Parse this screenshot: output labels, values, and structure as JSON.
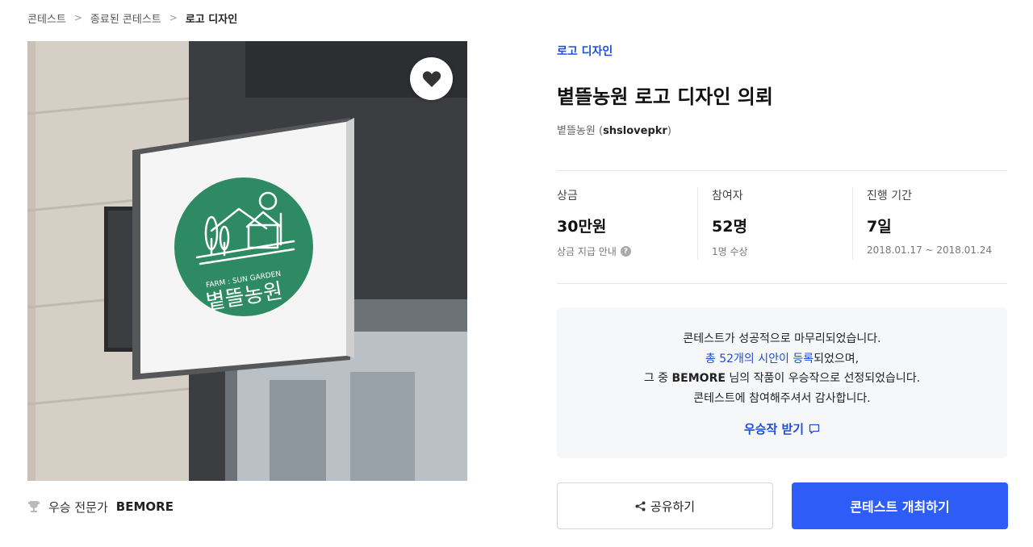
{
  "breadcrumb": {
    "items": [
      "콘테스트",
      "종료된 콘테스트",
      "로고 디자인"
    ]
  },
  "hero": {
    "logo_en": "FARM : SUN GARDEN",
    "logo_ko": "볕뜰농원",
    "logo_color": "#2e8a62"
  },
  "winner": {
    "label": "우승 전문가",
    "name": "BEMORE"
  },
  "contest": {
    "category": "로고 디자인",
    "title": "볕뜰농원 로고 디자인 의뢰",
    "owner_name": "볕뜰농원",
    "owner_id": "shslovepkr"
  },
  "stats": {
    "prize": {
      "label": "상금",
      "value": "30만원",
      "sub": "상금 지급 안내"
    },
    "participants": {
      "label": "참여자",
      "value": "52명",
      "sub": "1명 수상"
    },
    "period": {
      "label": "진행 기간",
      "value": "7일",
      "sub": "2018.01.17 ~ 2018.01.24"
    }
  },
  "notice": {
    "line1": "콘테스트가 성공적으로 마무리되었습니다.",
    "line2_link": "총 52개의 시안이 등록",
    "line2_rest": "되었으며,",
    "line3_pre": "그 중 ",
    "line3_name": "BEMORE",
    "line3_rest": " 님의 작품이 우승작으로 선정되었습니다.",
    "line4": "콘테스트에 참여해주셔서 감사합니다.",
    "get_winner": "우승작 받기"
  },
  "actions": {
    "share": "공유하기",
    "host": "콘테스트 개최하기"
  },
  "colors": {
    "accent": "#1f4fd9",
    "primary_button": "#2d5cf6"
  }
}
